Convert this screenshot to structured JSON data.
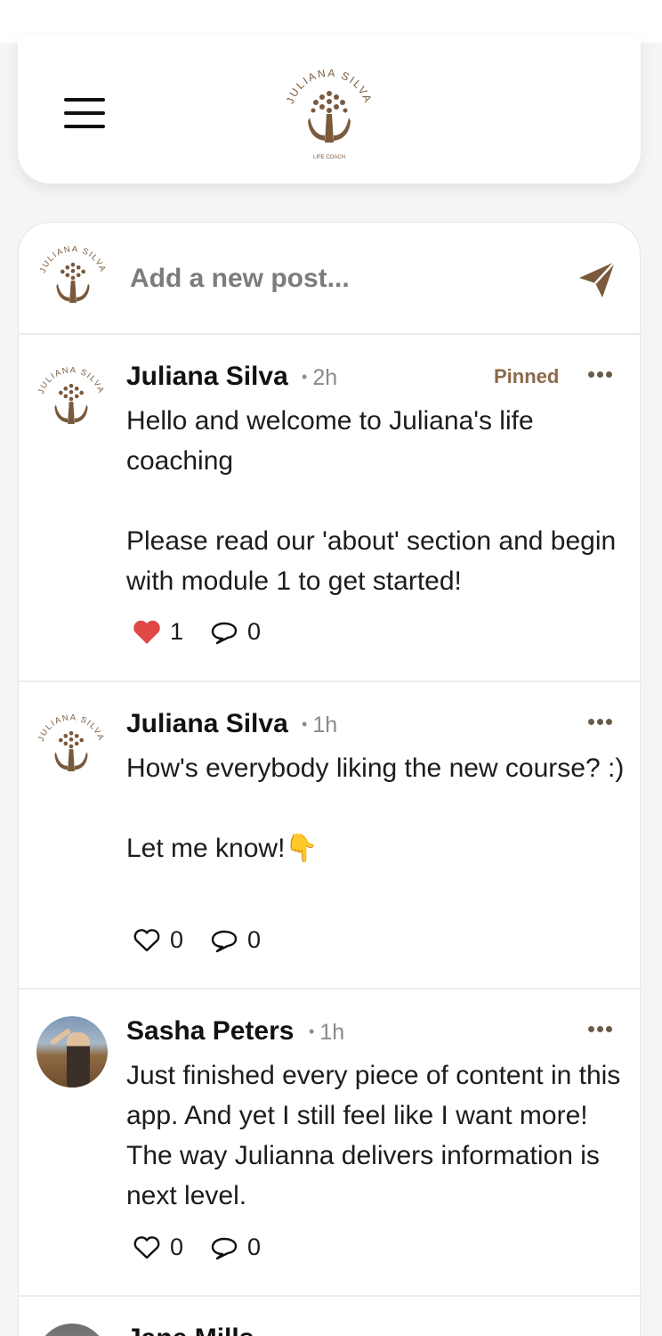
{
  "app": {
    "brand_top": "JULIANA SILVA",
    "brand_bottom": "LIFE COACH",
    "accent_color": "#7a5a3c",
    "like_active_color": "#e04848"
  },
  "header": {
    "menu_icon": "hamburger-menu-icon",
    "logo_icon": "juliana-silva-tree-logo"
  },
  "composer": {
    "placeholder": "Add a new post...",
    "send_icon": "paper-plane-icon"
  },
  "posts": [
    {
      "author": "Juliana Silva",
      "time": "2h",
      "pinned_label": "Pinned",
      "body": "Hello and welcome to Juliana's life coaching\n\nPlease read our 'about' section and begin with module 1 to get started!",
      "likes": "1",
      "comments": "0",
      "liked": true
    },
    {
      "author": "Juliana Silva",
      "time": "1h",
      "body": "How's everybody liking the new course? :)\n\nLet me know!👇",
      "likes": "0",
      "comments": "0",
      "liked": false
    },
    {
      "author": "Sasha Peters",
      "time": "1h",
      "body": "Just finished every piece of content in this app. And yet I still feel like I want more! The way Julianna delivers information is next level.",
      "likes": "0",
      "comments": "0",
      "liked": false
    },
    {
      "author": "Jane Mills"
    }
  ]
}
